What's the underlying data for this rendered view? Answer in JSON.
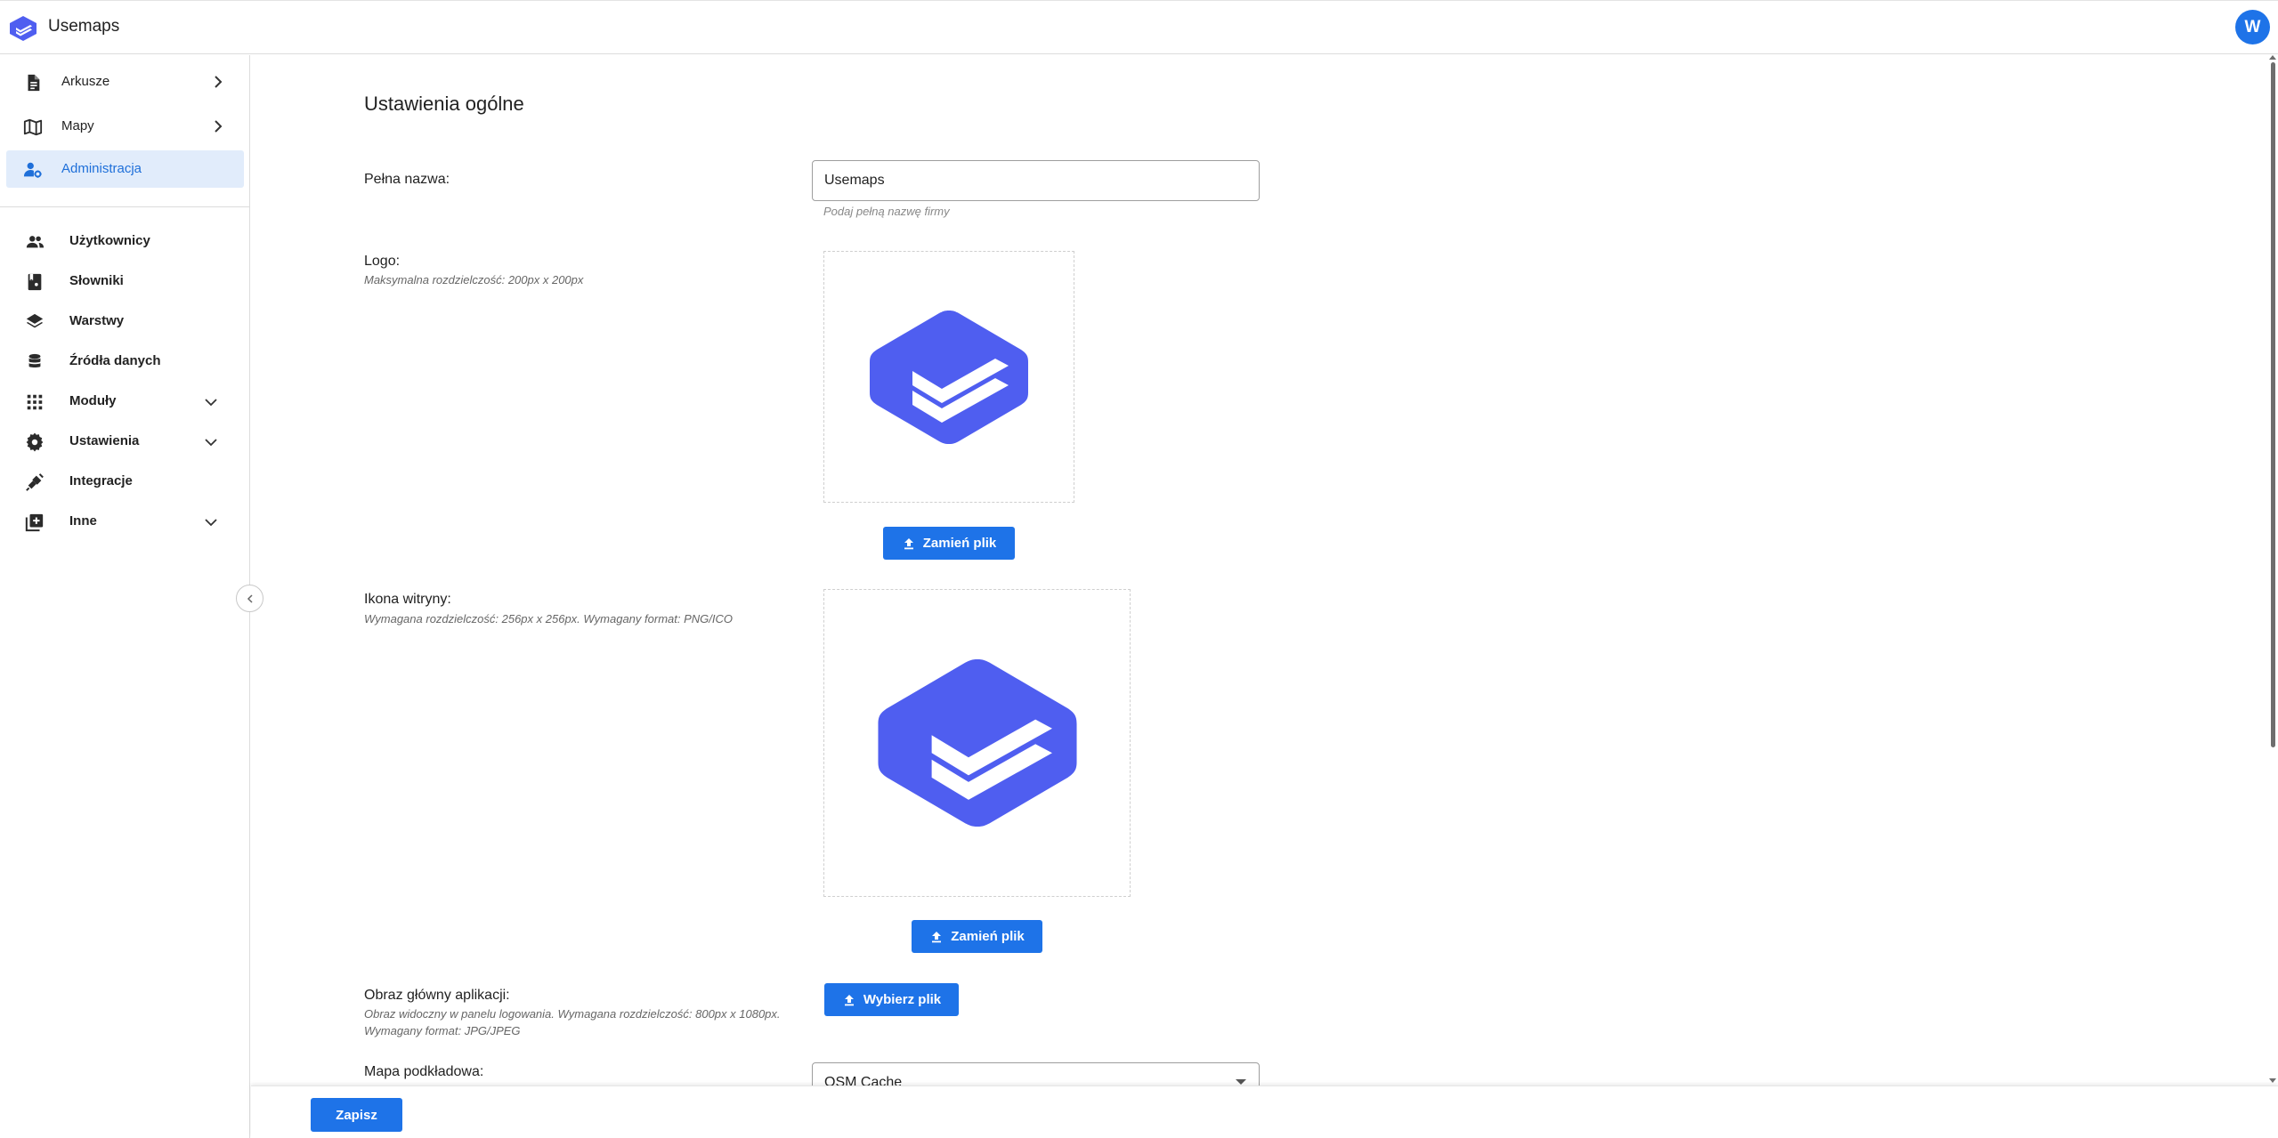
{
  "header": {
    "app_name": "Usemaps",
    "avatar_letter": "W",
    "accent_color": "#1e73e8",
    "logo_color": "#4f5ef0"
  },
  "sidebar": {
    "top_items": [
      {
        "label": "Arkusze",
        "icon": "sheet-icon",
        "has_chevron": true
      },
      {
        "label": "Mapy",
        "icon": "map-icon",
        "has_chevron": true
      },
      {
        "label": "Administracja",
        "icon": "admin-icon",
        "active": true
      }
    ],
    "sub_items": [
      {
        "label": "Użytkownicy",
        "icon": "users-icon"
      },
      {
        "label": "Słowniki",
        "icon": "dictionary-icon"
      },
      {
        "label": "Warstwy",
        "icon": "layers-icon"
      },
      {
        "label": "Źródła danych",
        "icon": "database-icon"
      },
      {
        "label": "Moduły",
        "icon": "grid-icon",
        "expandable": true
      },
      {
        "label": "Ustawienia",
        "icon": "gear-icon",
        "expandable": true
      },
      {
        "label": "Integracje",
        "icon": "plug-icon"
      },
      {
        "label": "Inne",
        "icon": "add-box-icon",
        "expandable": true
      }
    ]
  },
  "main": {
    "title": "Ustawienia ogólne",
    "full_name": {
      "label": "Pełna nazwa:",
      "value": "Usemaps",
      "helper": "Podaj pełną nazwę firmy"
    },
    "logo": {
      "label": "Logo:",
      "hint": "Maksymalna rozdzielczość: 200px x 200px",
      "button": "Zamień plik"
    },
    "favicon": {
      "label": "Ikona witryny:",
      "hint": "Wymagana rozdzielczość: 256px x 256px. Wymagany format: PNG/ICO",
      "button": "Zamień plik"
    },
    "main_image": {
      "label": "Obraz główny aplikacji:",
      "hint": "Obraz widoczny w panelu logowania. Wymagana rozdzielczość: 800px x 1080px. Wymagany format: JPG/JPEG",
      "button": "Wybierz plik"
    },
    "base_map": {
      "label": "Mapa podkładowa:",
      "value": "OSM Cache"
    }
  },
  "footer": {
    "save_label": "Zapisz"
  }
}
